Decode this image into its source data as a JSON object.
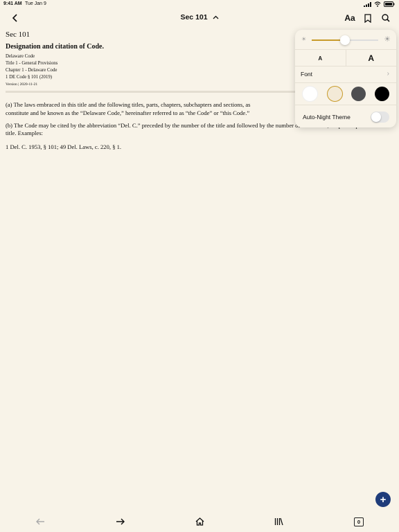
{
  "status": {
    "time": "9:41 AM",
    "date": "Tue Jan 9",
    "battery": "100%"
  },
  "nav": {
    "title": "Sec 101",
    "font_button": "Aa"
  },
  "doc": {
    "section": "Sec 101",
    "heading": "Designation and citation of Code.",
    "meta": [
      "Delaware Code",
      "Title 1 - General Provisions",
      "Chapter 1 - Delaware Code",
      "1 DE Code § 101 (2019)"
    ],
    "version": "Version | 2020-11-21",
    "para_a_1": "(a) The laws embraced in this title and the following titles, parts, chapters, subchapters and sections, as",
    "para_a_2": "constitute and be known as the “Delaware Code,” hereinafter referred to as “the Code” or “this Code.”",
    "para_b": "(b) The Code may be cited by the abbreviation “Del. C.” preceded by the number of the title and followed by the number of the section, chapter or part in the title. Examples:",
    "citation": "1 Del. C. 1953, § 101; 49 Del. Laws, c. 220, § 1."
  },
  "popover": {
    "brightness": 0.5,
    "font_small": "A",
    "font_large": "A",
    "font_label": "Font",
    "themes": [
      "white",
      "sepia",
      "gray",
      "black"
    ],
    "selected_theme": "sepia",
    "night_label": "Auto-Night Theme",
    "night_enabled": false
  },
  "toolbar": {
    "tab_count": "0"
  },
  "colors": {
    "background": "#f8f3e8",
    "accent": "#c89b2a",
    "fab": "#1f3c7a"
  }
}
